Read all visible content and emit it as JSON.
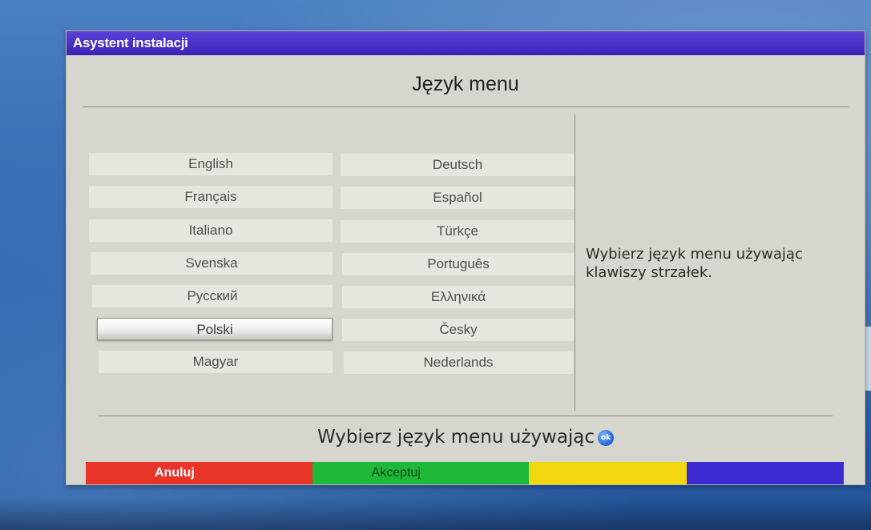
{
  "window": {
    "title": "Asystent instalacji"
  },
  "page": {
    "heading": "Język menu"
  },
  "languages": {
    "left": [
      "English",
      "Français",
      "Italiano",
      "Svenska",
      "Русский",
      "Polski",
      "Magyar"
    ],
    "right": [
      "Deutsch",
      "Español",
      "Türkçe",
      "Português",
      "Ελληνικά",
      "Česky",
      "Nederlands"
    ],
    "selected": "Polski"
  },
  "help": {
    "text": "Wybierz język menu używając klawiszy strzałek."
  },
  "footer": {
    "hint": "Wybierz język menu używając",
    "ok_icon_label": "ok"
  },
  "buttons": {
    "red": "Anuluj",
    "green": "Akceptuj",
    "yellow": "",
    "blue": ""
  },
  "colors": {
    "titlebar": "#3b22b5",
    "red": "#e7352a",
    "green": "#1fb83a",
    "yellow": "#f2d70f",
    "blue": "#3b2bd1"
  }
}
